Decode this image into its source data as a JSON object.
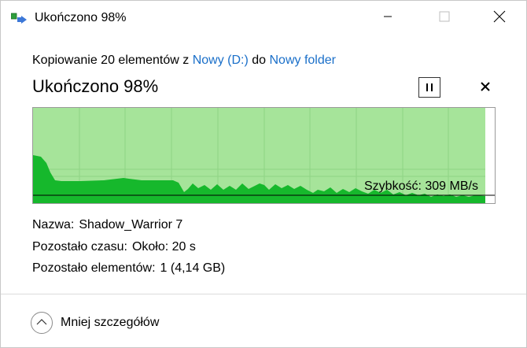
{
  "window": {
    "title": "Ukończono 98%"
  },
  "copy": {
    "prefix": "Kopiowanie 20 elementów z ",
    "source": "Nowy (D:)",
    "middle": " do ",
    "destination": "Nowy folder",
    "heading": "Ukończono 98%"
  },
  "graph": {
    "speed_label": "Szybkość: 309 MB/s",
    "progress_percent": 98,
    "colors": {
      "completed_area": "#a6e49a",
      "speed_fill": "#16b82c",
      "speed_line": "#000000",
      "grid": "#8fd384"
    }
  },
  "details": {
    "name_label": "Nazwa:",
    "name_value": "Shadow_Warrior 7",
    "time_label": "Pozostało czasu:",
    "time_value": "Około: 20 s",
    "items_label": "Pozostało elementów:",
    "items_value": "1 (4,14 GB)"
  },
  "footer": {
    "less_details": "Mniej szczegółów"
  },
  "icons": {
    "app": "file-copy-icon",
    "minimize": "minimize-icon",
    "maximize": "maximize-icon",
    "close": "close-icon",
    "pause": "pause-icon",
    "cancel": "cancel-icon",
    "collapse": "chevron-up-icon"
  }
}
